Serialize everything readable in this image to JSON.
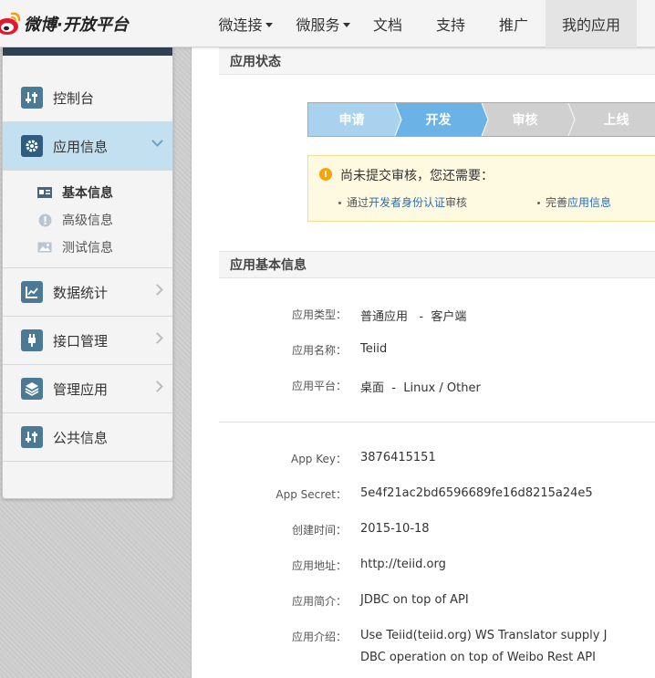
{
  "brand": {
    "logo_text": "微博·开放平台"
  },
  "nav": [
    {
      "label": "微连接",
      "has_caret": true
    },
    {
      "label": "微服务",
      "has_caret": true
    },
    {
      "label": "文档",
      "has_caret": false
    },
    {
      "label": "支持",
      "has_caret": false
    },
    {
      "label": "推广",
      "has_caret": false
    },
    {
      "label": "我的应用",
      "has_caret": false,
      "active": true
    }
  ],
  "sidebar": {
    "items": [
      {
        "label": "控制台",
        "icon": "sliders-icon"
      },
      {
        "label": "应用信息",
        "icon": "gear-icon",
        "active": true,
        "expanded": true
      },
      {
        "label": "数据统计",
        "icon": "chart-icon"
      },
      {
        "label": "接口管理",
        "icon": "plug-icon"
      },
      {
        "label": "管理应用",
        "icon": "layers-icon"
      },
      {
        "label": "公共信息",
        "icon": "sliders-icon"
      }
    ],
    "sub_items": [
      {
        "label": "基本信息",
        "icon": "id-card-icon",
        "active": true
      },
      {
        "label": "高级信息",
        "icon": "alert-icon"
      },
      {
        "label": "测试信息",
        "icon": "image-icon"
      }
    ]
  },
  "status_section": {
    "title": "应用状态",
    "steps": [
      "申请",
      "开发",
      "审核",
      "上线"
    ],
    "current_step": "开发",
    "notice": {
      "title": "尚未提交审核，您还需要：",
      "item1_prefix": "通过",
      "item1_link": "开发者身份认证",
      "item1_suffix": "审核",
      "item2_prefix": "完善",
      "item2_link": "应用信息"
    }
  },
  "basic_section": {
    "title": "应用基本信息",
    "fields": {
      "type_label": "应用类型：",
      "type_value": "普通应用   -  客户端",
      "name_label": "应用名称：",
      "name_value": "Teiid",
      "platform_label": "应用平台：",
      "platform_value": "桌面  -  Linux / Other",
      "key_label": "App Key：",
      "key_value": "3876415151",
      "secret_label": "App Secret：",
      "secret_value": "5e4f21ac2bd6596689fe16d8215a24e5",
      "created_label": "创建时间：",
      "created_value": "2015-10-18",
      "url_label": "应用地址：",
      "url_value": "http://teiid.org",
      "summary_label": "应用简介：",
      "summary_value": "JDBC on top of API",
      "intro_label": "应用介绍：",
      "intro_line1": "Use Teiid(teiid.org) WS Translator supply J",
      "intro_line2": "DBC operation on top of Weibo Rest API"
    }
  },
  "colors": {
    "accent": "#6bb3e6",
    "link": "#2a6db4",
    "sidebar_active": "#c3e0f0",
    "notice_bg": "#fefae1"
  }
}
